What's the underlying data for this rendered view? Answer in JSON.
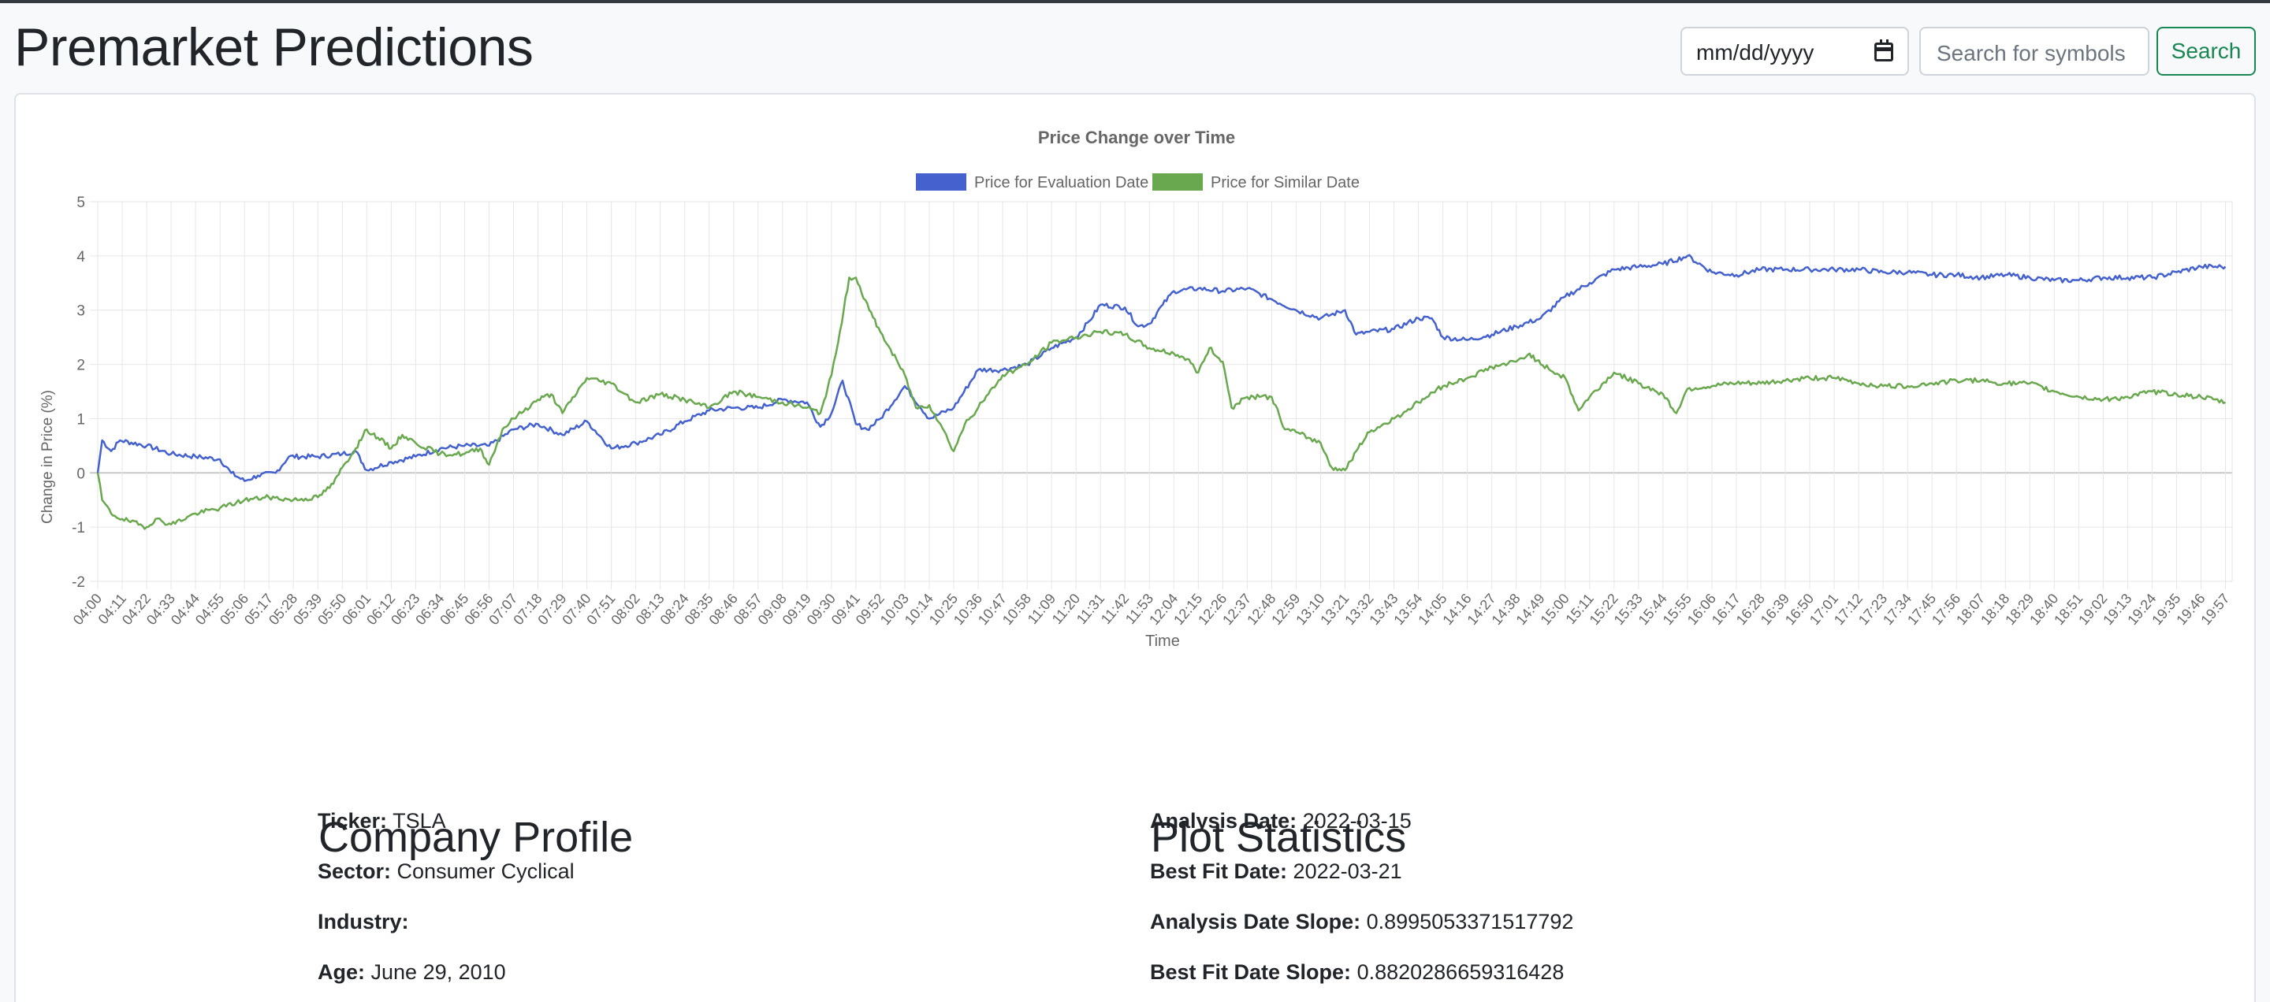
{
  "navbar": {
    "brand": "Premarket Predictions",
    "date_placeholder": "mm/dd/yyyy",
    "search_placeholder": "Search for symbols",
    "search_button": "Search"
  },
  "colors": {
    "eval_line": "#4461ce",
    "similar_line": "#6aa84f",
    "search_button": "#198754"
  },
  "chart_data": {
    "type": "line",
    "title": "Price Change over Time",
    "xlabel": "Time",
    "ylabel": "Change in Price (%)",
    "ylim": [
      -2,
      5
    ],
    "yticks": [
      -2,
      -1,
      0,
      1,
      2,
      3,
      4,
      5
    ],
    "xlim": [
      "04:00",
      "20:00"
    ],
    "legend_position": "top-center",
    "grid": true,
    "x_tick_labels": [
      "04:00",
      "04:11",
      "04:22",
      "04:33",
      "04:44",
      "04:55",
      "05:06",
      "05:17",
      "05:28",
      "05:39",
      "05:50",
      "06:01",
      "06:12",
      "06:23",
      "06:34",
      "06:45",
      "06:56",
      "07:07",
      "07:18",
      "07:29",
      "07:40",
      "07:51",
      "08:02",
      "08:13",
      "08:24",
      "08:35",
      "08:46",
      "08:57",
      "09:08",
      "09:19",
      "09:30",
      "09:41",
      "09:52",
      "10:03",
      "10:14",
      "10:25",
      "10:36",
      "10:47",
      "10:58",
      "11:09",
      "11:20",
      "11:31",
      "11:42",
      "11:53",
      "12:04",
      "12:15",
      "12:26",
      "12:37",
      "12:48",
      "12:59",
      "13:10",
      "13:21",
      "13:32",
      "13:43",
      "13:54",
      "14:05",
      "14:16",
      "14:27",
      "14:38",
      "14:49",
      "15:00",
      "15:11",
      "15:22",
      "15:33",
      "15:44",
      "15:55",
      "16:06",
      "16:17",
      "16:28",
      "16:39",
      "16:50",
      "17:01",
      "17:12",
      "17:23",
      "17:34",
      "17:45",
      "17:56",
      "18:07",
      "18:18",
      "18:29",
      "18:40",
      "18:51",
      "19:02",
      "19:13",
      "19:24",
      "19:35",
      "19:46",
      "19:57"
    ],
    "series": [
      {
        "name": "Price for Evaluation Date",
        "points": [
          [
            "04:00",
            0.0
          ],
          [
            "04:02",
            0.6
          ],
          [
            "04:06",
            0.4
          ],
          [
            "04:10",
            0.6
          ],
          [
            "04:22",
            0.5
          ],
          [
            "04:33",
            0.35
          ],
          [
            "04:44",
            0.3
          ],
          [
            "04:55",
            0.25
          ],
          [
            "05:00",
            0.0
          ],
          [
            "05:06",
            -0.15
          ],
          [
            "05:12",
            -0.05
          ],
          [
            "05:20",
            0.0
          ],
          [
            "05:26",
            0.3
          ],
          [
            "05:39",
            0.3
          ],
          [
            "05:50",
            0.35
          ],
          [
            "05:56",
            0.4
          ],
          [
            "06:01",
            0.05
          ],
          [
            "06:12",
            0.2
          ],
          [
            "06:23",
            0.3
          ],
          [
            "06:34",
            0.45
          ],
          [
            "06:45",
            0.5
          ],
          [
            "06:56",
            0.5
          ],
          [
            "07:07",
            0.8
          ],
          [
            "07:18",
            0.9
          ],
          [
            "07:29",
            0.7
          ],
          [
            "07:40",
            0.95
          ],
          [
            "07:51",
            0.45
          ],
          [
            "08:02",
            0.55
          ],
          [
            "08:13",
            0.7
          ],
          [
            "08:24",
            0.95
          ],
          [
            "08:35",
            1.15
          ],
          [
            "08:46",
            1.2
          ],
          [
            "08:57",
            1.2
          ],
          [
            "09:08",
            1.35
          ],
          [
            "09:19",
            1.3
          ],
          [
            "09:25",
            0.85
          ],
          [
            "09:30",
            1.1
          ],
          [
            "09:35",
            1.7
          ],
          [
            "09:41",
            0.9
          ],
          [
            "09:46",
            0.8
          ],
          [
            "09:52",
            1.0
          ],
          [
            "10:03",
            1.6
          ],
          [
            "10:14",
            1.0
          ],
          [
            "10:25",
            1.2
          ],
          [
            "10:36",
            1.9
          ],
          [
            "10:47",
            1.9
          ],
          [
            "10:58",
            2.0
          ],
          [
            "11:09",
            2.3
          ],
          [
            "11:20",
            2.5
          ],
          [
            "11:26",
            2.8
          ],
          [
            "11:31",
            3.1
          ],
          [
            "11:42",
            3.05
          ],
          [
            "11:48",
            2.7
          ],
          [
            "11:53",
            2.75
          ],
          [
            "11:59",
            3.1
          ],
          [
            "12:04",
            3.35
          ],
          [
            "12:15",
            3.4
          ],
          [
            "12:26",
            3.35
          ],
          [
            "12:37",
            3.4
          ],
          [
            "12:48",
            3.2
          ],
          [
            "12:59",
            3.0
          ],
          [
            "13:10",
            2.85
          ],
          [
            "13:21",
            3.0
          ],
          [
            "13:26",
            2.55
          ],
          [
            "13:32",
            2.6
          ],
          [
            "13:43",
            2.65
          ],
          [
            "13:54",
            2.85
          ],
          [
            "14:00",
            2.85
          ],
          [
            "14:05",
            2.5
          ],
          [
            "14:16",
            2.45
          ],
          [
            "14:27",
            2.55
          ],
          [
            "14:38",
            2.7
          ],
          [
            "14:49",
            2.85
          ],
          [
            "15:00",
            3.25
          ],
          [
            "15:11",
            3.5
          ],
          [
            "15:22",
            3.75
          ],
          [
            "15:33",
            3.8
          ],
          [
            "15:44",
            3.85
          ],
          [
            "15:55",
            4.0
          ],
          [
            "16:06",
            3.7
          ],
          [
            "16:17",
            3.65
          ],
          [
            "16:28",
            3.75
          ],
          [
            "16:39",
            3.75
          ],
          [
            "16:50",
            3.75
          ],
          [
            "17:01",
            3.75
          ],
          [
            "17:12",
            3.75
          ],
          [
            "17:23",
            3.7
          ],
          [
            "17:34",
            3.7
          ],
          [
            "17:45",
            3.65
          ],
          [
            "17:56",
            3.65
          ],
          [
            "18:07",
            3.6
          ],
          [
            "18:18",
            3.65
          ],
          [
            "18:29",
            3.6
          ],
          [
            "18:40",
            3.55
          ],
          [
            "18:51",
            3.55
          ],
          [
            "19:02",
            3.6
          ],
          [
            "19:13",
            3.6
          ],
          [
            "19:24",
            3.6
          ],
          [
            "19:35",
            3.7
          ],
          [
            "19:46",
            3.8
          ],
          [
            "19:57",
            3.8
          ]
        ]
      },
      {
        "name": "Price for Similar Date",
        "points": [
          [
            "04:00",
            0.0
          ],
          [
            "04:02",
            -0.5
          ],
          [
            "04:06",
            -0.75
          ],
          [
            "04:11",
            -0.85
          ],
          [
            "04:22",
            -1.0
          ],
          [
            "04:26",
            -0.85
          ],
          [
            "04:33",
            -0.95
          ],
          [
            "04:44",
            -0.75
          ],
          [
            "04:55",
            -0.65
          ],
          [
            "05:06",
            -0.5
          ],
          [
            "05:17",
            -0.45
          ],
          [
            "05:28",
            -0.5
          ],
          [
            "05:39",
            -0.45
          ],
          [
            "05:46",
            -0.2
          ],
          [
            "05:50",
            0.1
          ],
          [
            "05:56",
            0.45
          ],
          [
            "06:01",
            0.8
          ],
          [
            "06:06",
            0.65
          ],
          [
            "06:12",
            0.45
          ],
          [
            "06:17",
            0.7
          ],
          [
            "06:23",
            0.55
          ],
          [
            "06:34",
            0.35
          ],
          [
            "06:45",
            0.35
          ],
          [
            "06:52",
            0.45
          ],
          [
            "06:56",
            0.15
          ],
          [
            "07:02",
            0.8
          ],
          [
            "07:07",
            1.0
          ],
          [
            "07:18",
            1.35
          ],
          [
            "07:24",
            1.45
          ],
          [
            "07:29",
            1.1
          ],
          [
            "07:40",
            1.75
          ],
          [
            "07:51",
            1.65
          ],
          [
            "08:02",
            1.3
          ],
          [
            "08:13",
            1.45
          ],
          [
            "08:24",
            1.35
          ],
          [
            "08:35",
            1.2
          ],
          [
            "08:46",
            1.5
          ],
          [
            "08:57",
            1.4
          ],
          [
            "09:08",
            1.3
          ],
          [
            "09:19",
            1.2
          ],
          [
            "09:25",
            1.1
          ],
          [
            "09:30",
            1.8
          ],
          [
            "09:33",
            2.4
          ],
          [
            "09:38",
            3.6
          ],
          [
            "09:41",
            3.6
          ],
          [
            "09:47",
            3.0
          ],
          [
            "09:52",
            2.6
          ],
          [
            "10:03",
            1.8
          ],
          [
            "10:08",
            1.2
          ],
          [
            "10:14",
            1.25
          ],
          [
            "10:19",
            0.9
          ],
          [
            "10:25",
            0.4
          ],
          [
            "10:30",
            0.9
          ],
          [
            "10:36",
            1.2
          ],
          [
            "10:47",
            1.8
          ],
          [
            "10:58",
            2.0
          ],
          [
            "11:09",
            2.4
          ],
          [
            "11:20",
            2.5
          ],
          [
            "11:31",
            2.6
          ],
          [
            "11:42",
            2.55
          ],
          [
            "11:53",
            2.3
          ],
          [
            "12:04",
            2.2
          ],
          [
            "12:10",
            2.1
          ],
          [
            "12:15",
            1.85
          ],
          [
            "12:20",
            2.3
          ],
          [
            "12:26",
            2.05
          ],
          [
            "12:30",
            1.2
          ],
          [
            "12:37",
            1.4
          ],
          [
            "12:48",
            1.4
          ],
          [
            "12:54",
            0.8
          ],
          [
            "12:59",
            0.75
          ],
          [
            "13:10",
            0.55
          ],
          [
            "13:15",
            0.1
          ],
          [
            "13:21",
            0.05
          ],
          [
            "13:26",
            0.4
          ],
          [
            "13:32",
            0.75
          ],
          [
            "13:43",
            1.0
          ],
          [
            "13:54",
            1.3
          ],
          [
            "14:05",
            1.6
          ],
          [
            "14:16",
            1.75
          ],
          [
            "14:27",
            1.95
          ],
          [
            "14:38",
            2.05
          ],
          [
            "14:44",
            2.2
          ],
          [
            "14:49",
            2.0
          ],
          [
            "15:00",
            1.75
          ],
          [
            "15:06",
            1.15
          ],
          [
            "15:11",
            1.4
          ],
          [
            "15:22",
            1.85
          ],
          [
            "15:33",
            1.65
          ],
          [
            "15:44",
            1.45
          ],
          [
            "15:50",
            1.1
          ],
          [
            "15:55",
            1.55
          ],
          [
            "16:06",
            1.6
          ],
          [
            "16:17",
            1.65
          ],
          [
            "16:28",
            1.65
          ],
          [
            "16:39",
            1.7
          ],
          [
            "16:50",
            1.75
          ],
          [
            "17:01",
            1.75
          ],
          [
            "17:12",
            1.65
          ],
          [
            "17:23",
            1.6
          ],
          [
            "17:34",
            1.6
          ],
          [
            "17:45",
            1.65
          ],
          [
            "17:56",
            1.7
          ],
          [
            "18:07",
            1.7
          ],
          [
            "18:18",
            1.65
          ],
          [
            "18:29",
            1.65
          ],
          [
            "18:40",
            1.5
          ],
          [
            "18:51",
            1.4
          ],
          [
            "19:02",
            1.35
          ],
          [
            "19:13",
            1.4
          ],
          [
            "19:24",
            1.5
          ],
          [
            "19:35",
            1.45
          ],
          [
            "19:46",
            1.4
          ],
          [
            "19:57",
            1.3
          ]
        ]
      }
    ]
  },
  "profile": {
    "heading": "Company Profile",
    "ticker_label": "Ticker:",
    "ticker_value": "TSLA",
    "sector_label": "Sector:",
    "sector_value": "Consumer Cyclical",
    "industry_label": "Industry:",
    "industry_value": "",
    "age_label": "Age:",
    "age_value": "June 29, 2010"
  },
  "stats": {
    "heading": "Plot Statistics",
    "analysis_date_label": "Analysis Date:",
    "analysis_date_value": "2022-03-15",
    "best_fit_date_label": "Best Fit Date:",
    "best_fit_date_value": "2022-03-21",
    "analysis_slope_label": "Analysis Date Slope:",
    "analysis_slope_value": "0.8995053371517792",
    "best_fit_slope_label": "Best Fit Date Slope:",
    "best_fit_slope_value": "0.8820286659316428"
  }
}
